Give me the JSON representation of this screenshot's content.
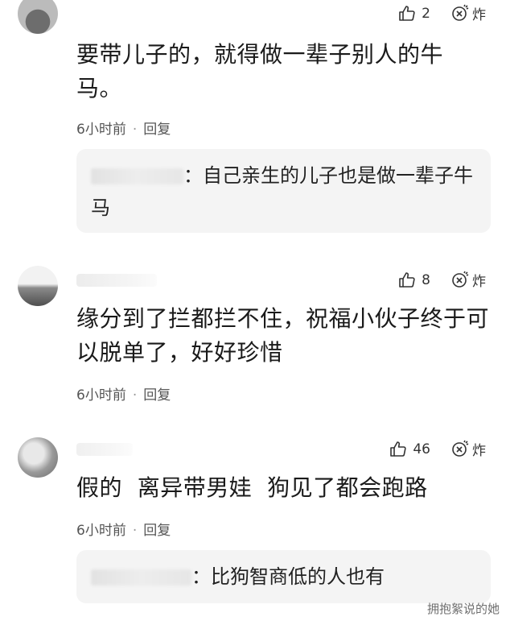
{
  "comments": [
    {
      "likes": "2",
      "burst_label": "炸",
      "text": "要带儿子的，就得做一辈子别人的牛马。",
      "time": "6小时前",
      "reply_label": "回复",
      "reply": {
        "text": "自己亲生的儿子也是做一辈子牛马"
      }
    },
    {
      "likes": "8",
      "burst_label": "炸",
      "text": "缘分到了拦都拦不住，祝福小伙子终于可以脱单了，好好珍惜",
      "time": "6小时前",
      "reply_label": "回复"
    },
    {
      "likes": "46",
      "burst_label": "炸",
      "text": "假的  离异带男娃  狗见了都会跑路",
      "time": "6小时前",
      "reply_label": "回复",
      "reply": {
        "text": "比狗智商低的人也有"
      }
    }
  ],
  "watermark": "拥抱絮说的她",
  "icons": {
    "like": "thumbs-up-icon",
    "burst": "burst-icon"
  }
}
